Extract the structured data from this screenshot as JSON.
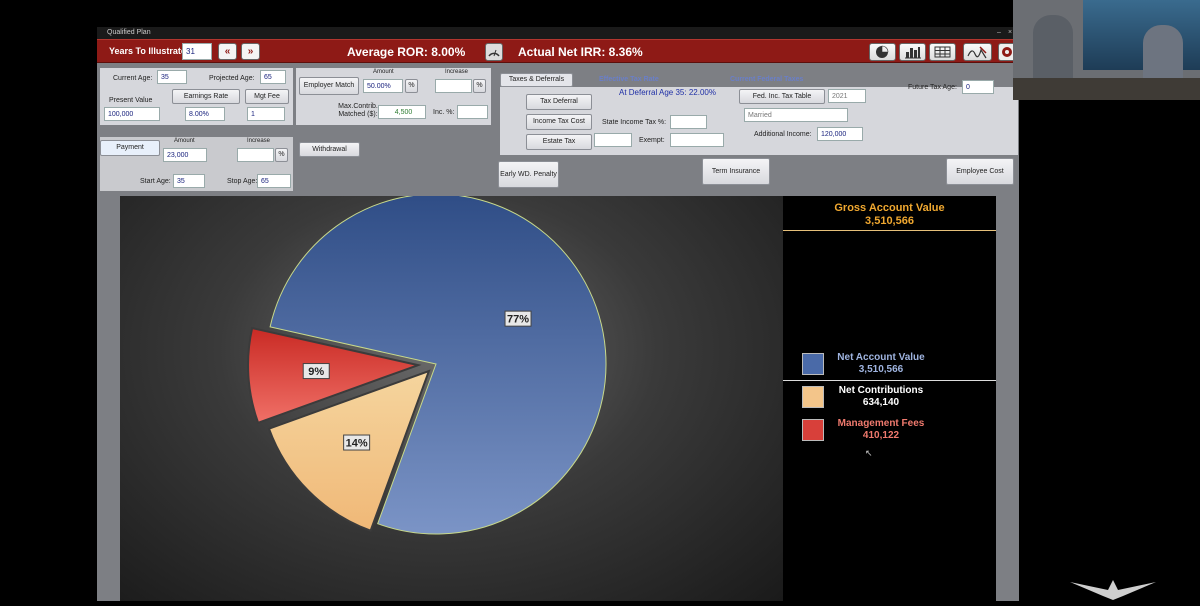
{
  "window": {
    "title": "Qualified Plan"
  },
  "toolbar": {
    "years_label": "Years To Illustrate:",
    "years_value": "31",
    "avg_ror": "Average ROR: 8.00%",
    "net_irr": "Actual Net IRR: 8.36%"
  },
  "inputs": {
    "current_age_label": "Current Age:",
    "current_age": "35",
    "projected_age_label": "Projected Age:",
    "projected_age": "65",
    "present_value_label": "Present Value",
    "present_value": "100,000",
    "earnings_rate_label": "Earnings Rate",
    "earnings_rate": "8.00%",
    "mgt_fee_label": "Mgt Fee",
    "mgt_fee": "1",
    "employer_match_label": "Employer Match",
    "amount_label": "Amount",
    "increase_label": "Increase",
    "employer_match_value": "50.00%",
    "percent": "%",
    "max_contrib_label": "Max.Contrib. Matched ($):",
    "max_contrib_value": "4,500",
    "inc_label": "Inc. %:",
    "payment_label": "Payment",
    "payment_amount": "23,000",
    "withdrawal_label": "Withdrawal",
    "start_age_label": "Start Age:",
    "start_age": "35",
    "stop_age_label": "Stop Age:",
    "stop_age": "65"
  },
  "taxes": {
    "tab_label": "Taxes & Deferrals",
    "eff_rate_header": "Effective Tax Rate",
    "deferral_text": "At Deferral Age 35: 22.00%",
    "fed_header": "Current Federal Taxes",
    "tax_deferral": "Tax Deferral",
    "income_tax_cost": "Income Tax Cost",
    "estate_tax": "Estate Tax",
    "state_tax_label": "State Income Tax %:",
    "exempt_label": "Exempt:",
    "fed_table": "Fed. Inc. Tax Table",
    "year": "2021",
    "filing": "Married",
    "additional_income_label": "Additional Income:",
    "additional_income": "120,000",
    "future_tax_age_label": "Future Tax Age:",
    "future_tax_age": "0"
  },
  "buttons": {
    "early_wd": "Early WD. Penalty",
    "term_insurance": "Term Insurance",
    "employee_cost": "Employee Cost"
  },
  "icons": [
    "pie-chart-icon",
    "bar-chart-icon",
    "table-icon",
    "signature-icon",
    "settings-icon"
  ],
  "chart_data": {
    "type": "pie",
    "title": "Gross Account Value",
    "subtitle": "3,510,566",
    "slices": [
      {
        "label": "Net Account Value",
        "value": 3510566,
        "display": "3,510,566",
        "percent_label": "77%",
        "color": "#4a6aa8"
      },
      {
        "label": "Net Contributions",
        "value": 634140,
        "display": "634,140",
        "percent_label": "14%",
        "color": "#f3c58a"
      },
      {
        "label": "Management Fees",
        "value": 410122,
        "display": "410,122",
        "percent_label": "9%",
        "color": "#d8403a"
      }
    ],
    "legend_position": "right"
  }
}
